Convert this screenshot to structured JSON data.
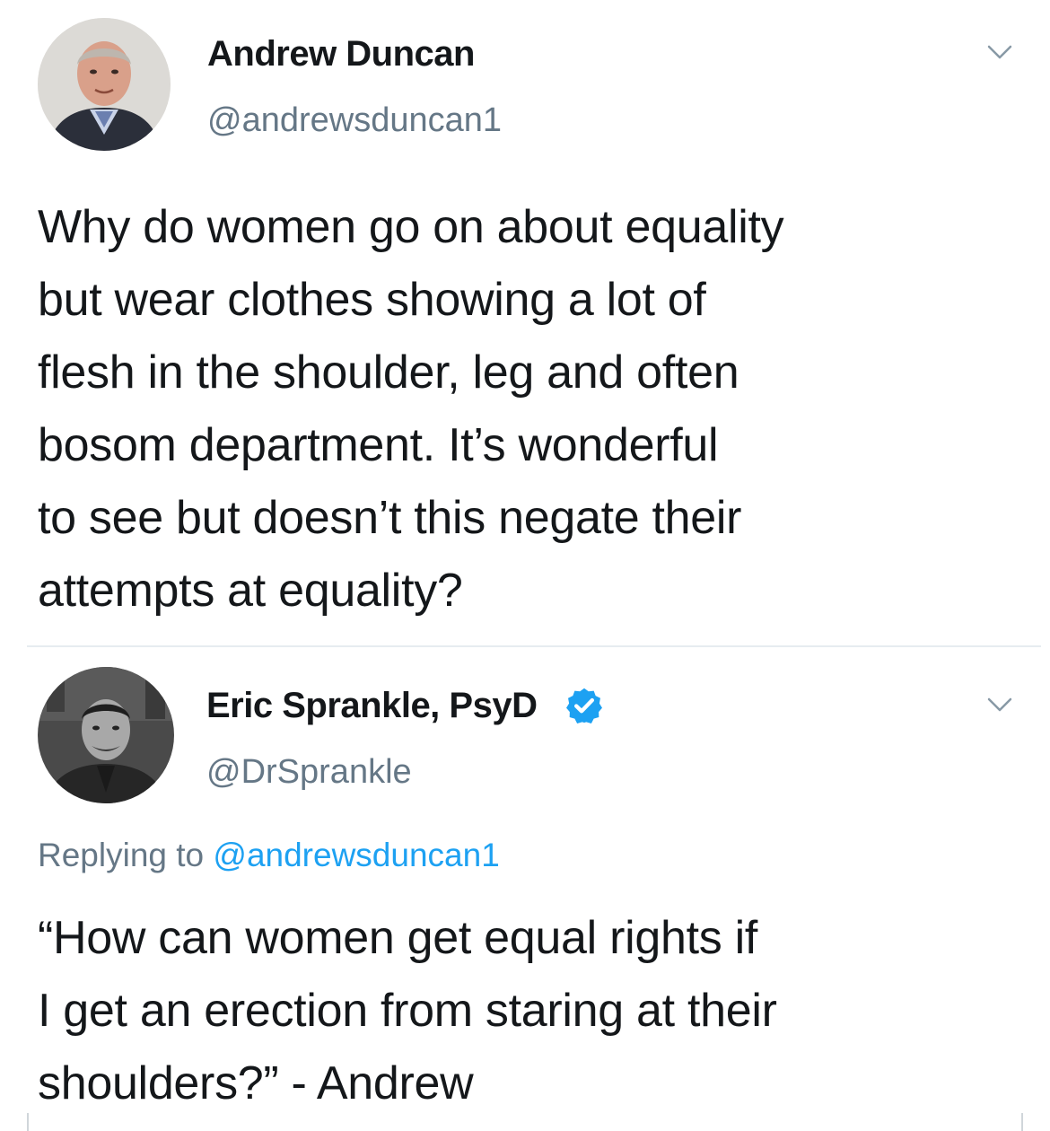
{
  "tweets": [
    {
      "display_name": "Andrew Duncan",
      "handle": "@andrewsduncan1",
      "text_lines": [
        "Why do women go on about equality",
        "but wear clothes showing a lot of",
        "flesh in the shoulder, leg and often",
        "bosom department. It’s wonderful",
        "to see but doesn’t this negate their",
        "attempts at equality?"
      ],
      "avatar_icon": "profile-photo",
      "menu_icon": "chevron-down-icon"
    },
    {
      "display_name": "Eric Sprankle, PsyD",
      "verified": true,
      "handle": "@DrSprankle",
      "reply_prefix": "Replying to",
      "reply_mention": "@andrewsduncan1",
      "text_lines": [
        "“How can women get equal rights if",
        "I get an erection from staring at their",
        "shoulders?” - Andrew"
      ],
      "avatar_icon": "profile-photo",
      "menu_icon": "chevron-down-icon"
    }
  ],
  "colors": {
    "name": "#14171a",
    "secondary": "#657786",
    "link": "#1da1f2",
    "verified": "#1da1f2",
    "divider": "#e6ecf0"
  }
}
